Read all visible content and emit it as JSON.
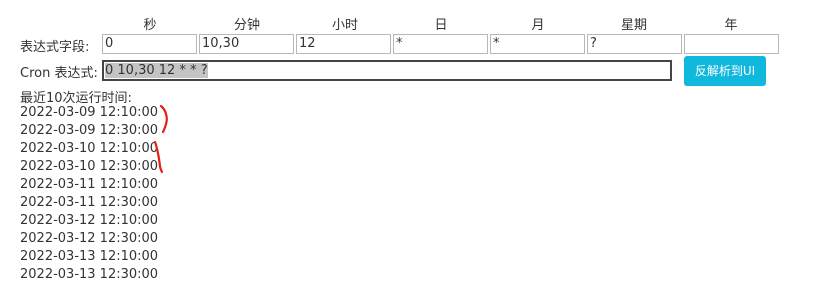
{
  "headers": [
    "秒",
    "分钟",
    "小时",
    "日",
    "月",
    "星期",
    "年"
  ],
  "fields_label": "表达式字段:",
  "fields": [
    "0",
    "10,30",
    "12",
    "*",
    "*",
    "?",
    ""
  ],
  "cron_label": "Cron 表达式:",
  "cron_value": "0 10,30 12 * * ?",
  "parse_button": "反解析到UI",
  "runs_label": "最近10次运行时间:",
  "runs": [
    "2022-03-09 12:10:00",
    "2022-03-09 12:30:00",
    "2022-03-10 12:10:00",
    "2022-03-10 12:30:00",
    "2022-03-11 12:10:00",
    "2022-03-11 12:30:00",
    "2022-03-12 12:10:00",
    "2022-03-12 12:30:00",
    "2022-03-13 12:10:00",
    "2022-03-13 12:30:00"
  ],
  "colors": {
    "button": "#0fb8dc",
    "annotation": "#e0201a"
  }
}
